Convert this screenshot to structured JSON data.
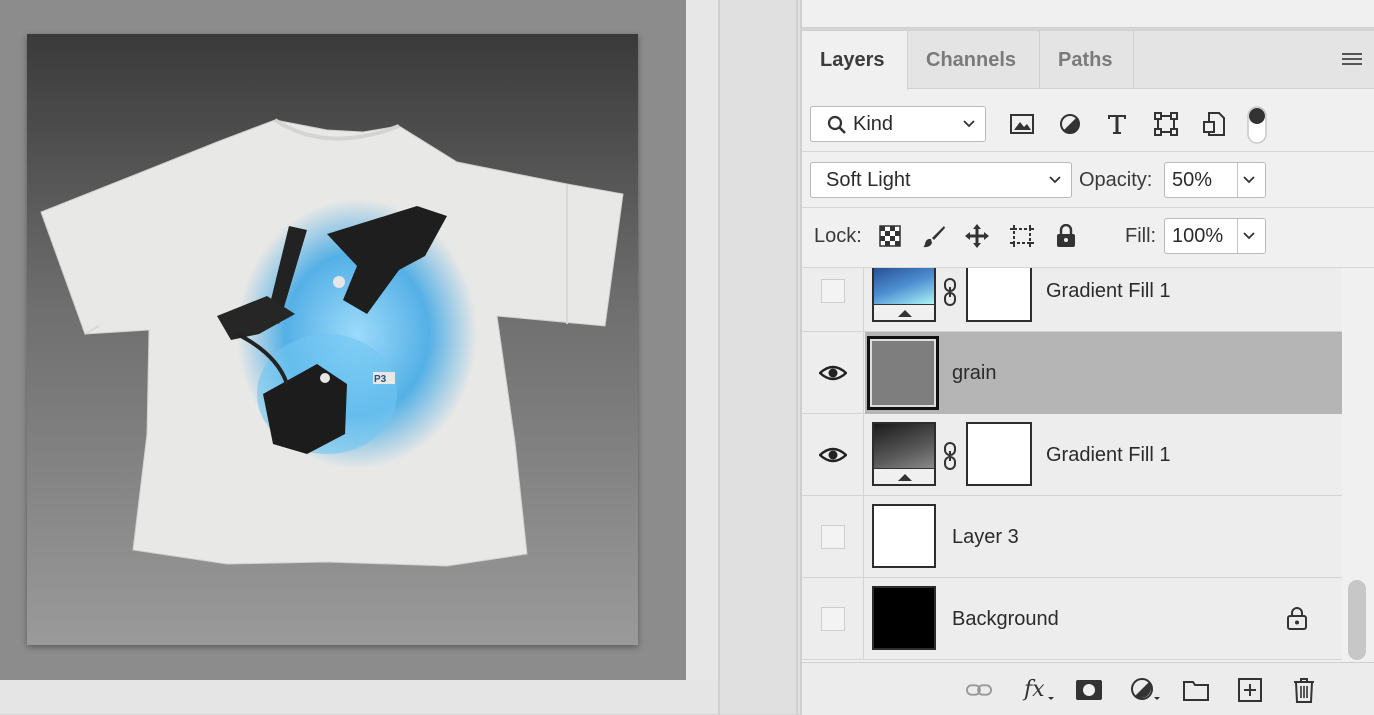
{
  "layers_panel": {
    "tabs": [
      {
        "label": "Layers",
        "active": true
      },
      {
        "label": "Channels",
        "active": false
      },
      {
        "label": "Paths",
        "active": false
      }
    ],
    "filter": {
      "label": "Kind",
      "icon": "search-icon"
    },
    "filter_icons": [
      "image-filter-icon",
      "adjustment-filter-icon",
      "type-filter-icon",
      "shape-filter-icon",
      "smart-object-filter-icon",
      "filter-toggle-icon"
    ],
    "blend_mode": "Soft Light",
    "opacity_label": "Opacity:",
    "opacity_value": "50%",
    "lock_label": "Lock:",
    "fill_label": "Fill:",
    "fill_value": "100%",
    "layers": [
      {
        "name": "Gradient Fill 1",
        "visible": false,
        "type": "gradient-blue",
        "has_mask": true,
        "selected": false,
        "locked": false
      },
      {
        "name": "grain",
        "visible": true,
        "type": "noise",
        "has_mask": false,
        "selected": true,
        "locked": false
      },
      {
        "name": "Gradient Fill 1",
        "visible": true,
        "type": "gradient-gray",
        "has_mask": true,
        "selected": false,
        "locked": false
      },
      {
        "name": "Layer 3",
        "visible": false,
        "type": "white",
        "has_mask": false,
        "selected": false,
        "locked": false
      },
      {
        "name": "Background",
        "visible": false,
        "type": "black",
        "has_mask": false,
        "selected": false,
        "locked": true
      }
    ],
    "footer_icons": [
      "link-layers-icon",
      "fx-icon",
      "add-mask-icon",
      "adjustment-layer-icon",
      "group-folder-icon",
      "new-layer-icon",
      "delete-layer-icon"
    ]
  },
  "canvas": {
    "artwork": "t-shirt with blue and black graphic print",
    "shirt_label": "P3"
  }
}
